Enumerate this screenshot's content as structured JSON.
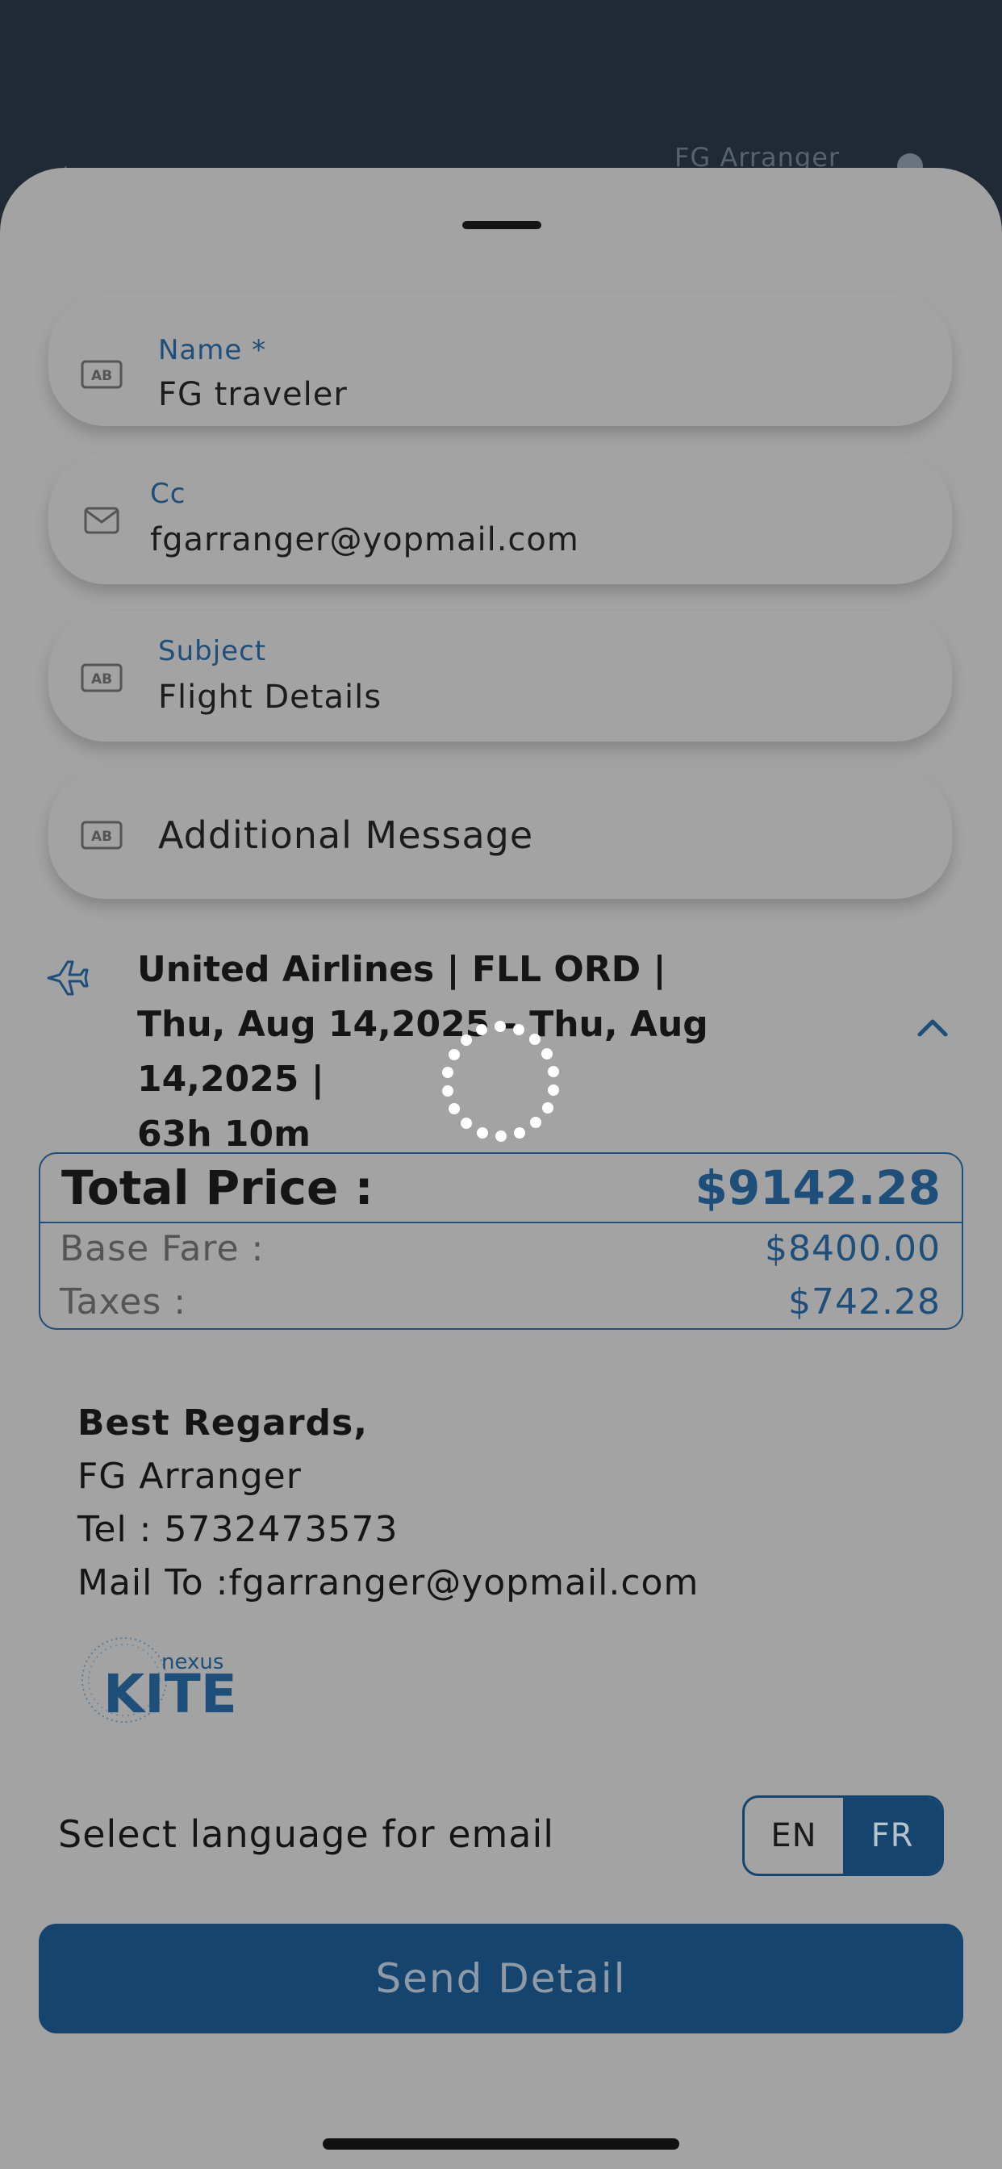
{
  "background": {
    "title": "FG  Arranger"
  },
  "form": {
    "name": {
      "label": "Name *",
      "value": "FG traveler",
      "icon": "text-field-icon"
    },
    "cc": {
      "label": "Cc",
      "value": "fgarranger@yopmail.com",
      "icon": "mail-icon"
    },
    "subject": {
      "label": "Subject",
      "value": "Flight Details",
      "icon": "text-field-icon"
    },
    "message": {
      "placeholder": "Additional Message",
      "icon": "text-field-icon"
    }
  },
  "flight": {
    "line1": "United Airlines | FLL ORD |",
    "line2": "Thu, Aug 14,2025 - Thu, Aug 14,2025 |",
    "line3": "63h 10m",
    "icon": "airplane-icon"
  },
  "price": {
    "total_label": "Total Price :",
    "total_value": "$9142.28",
    "base_label": "Base Fare :",
    "base_value": "$8400.00",
    "taxes_label": "Taxes :",
    "taxes_value": "$742.28"
  },
  "signature": {
    "greeting": "Best Regards,",
    "name": "FG  Arranger",
    "tel": "Tel : 5732473573",
    "mail": "Mail To :fgarranger@yopmail.com"
  },
  "logo": {
    "small": "nexus",
    "big": "KITE"
  },
  "language": {
    "label": "Select language for email",
    "options": [
      "EN",
      "FR"
    ],
    "selected": "FR"
  },
  "send_button": "Send Detail",
  "colors": {
    "accent": "#1d4f7a",
    "button": "#15446e",
    "sheet": "#a3a3a3"
  }
}
